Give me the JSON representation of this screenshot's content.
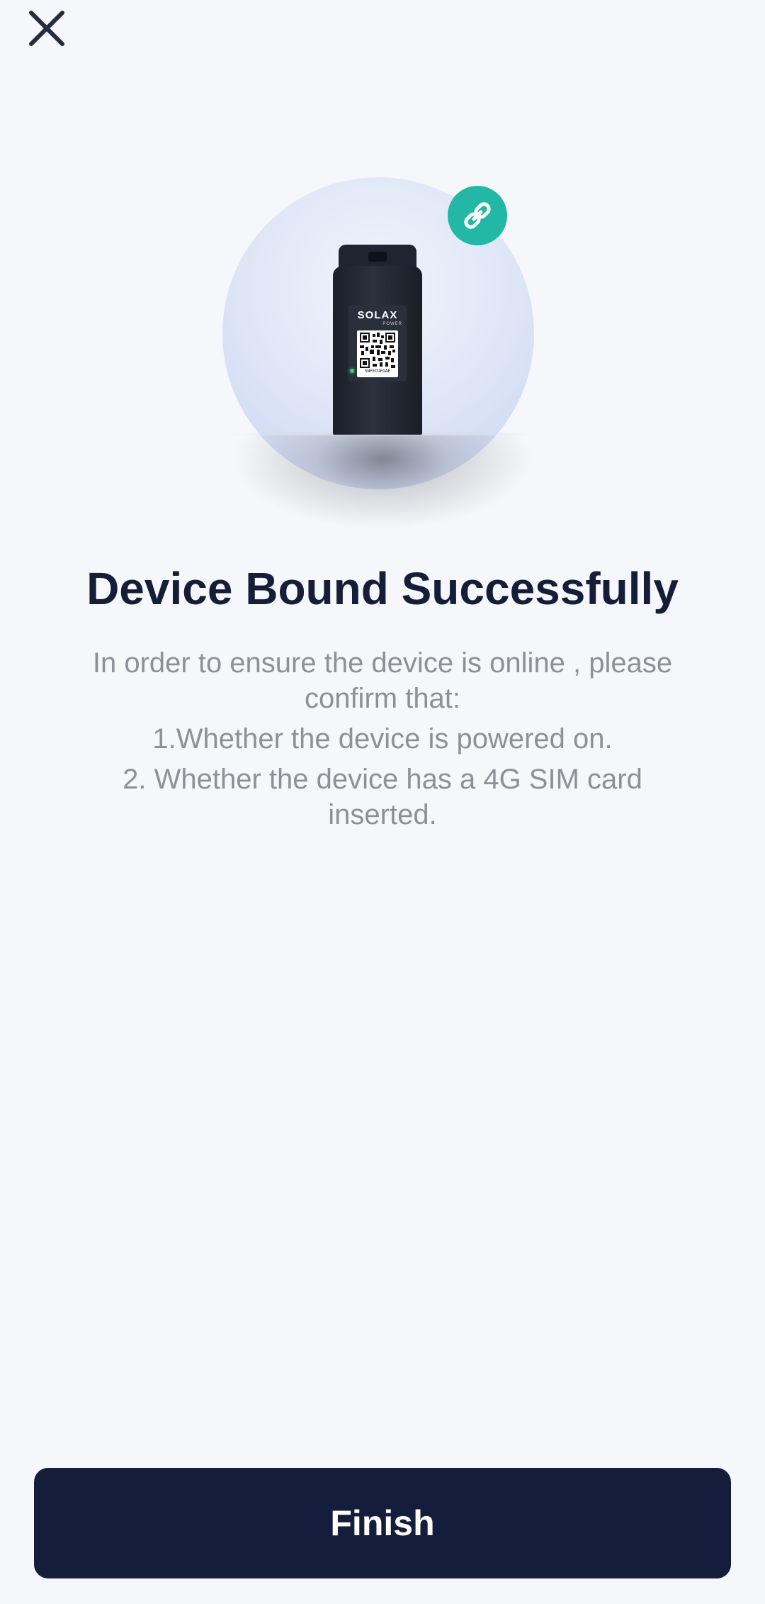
{
  "header": {
    "close_icon": "close-icon"
  },
  "hero": {
    "badge_icon": "link-icon",
    "badge_color": "#22b8a5",
    "device": {
      "brand": "SOLAX",
      "brand_sub": "POWER",
      "serial": "SNFECUFGAE"
    }
  },
  "content": {
    "title": "Device Bound Successfully",
    "intro": "In order to ensure the device is online , please confirm that:",
    "item_1": "1.Whether the device is powered on.",
    "item_2": "2. Whether the device has a 4G SIM card inserted."
  },
  "footer": {
    "finish_label": "Finish"
  },
  "colors": {
    "background": "#f6f7fb",
    "title": "#151d38",
    "body_text": "#8d9097",
    "button": "#141d3b"
  }
}
